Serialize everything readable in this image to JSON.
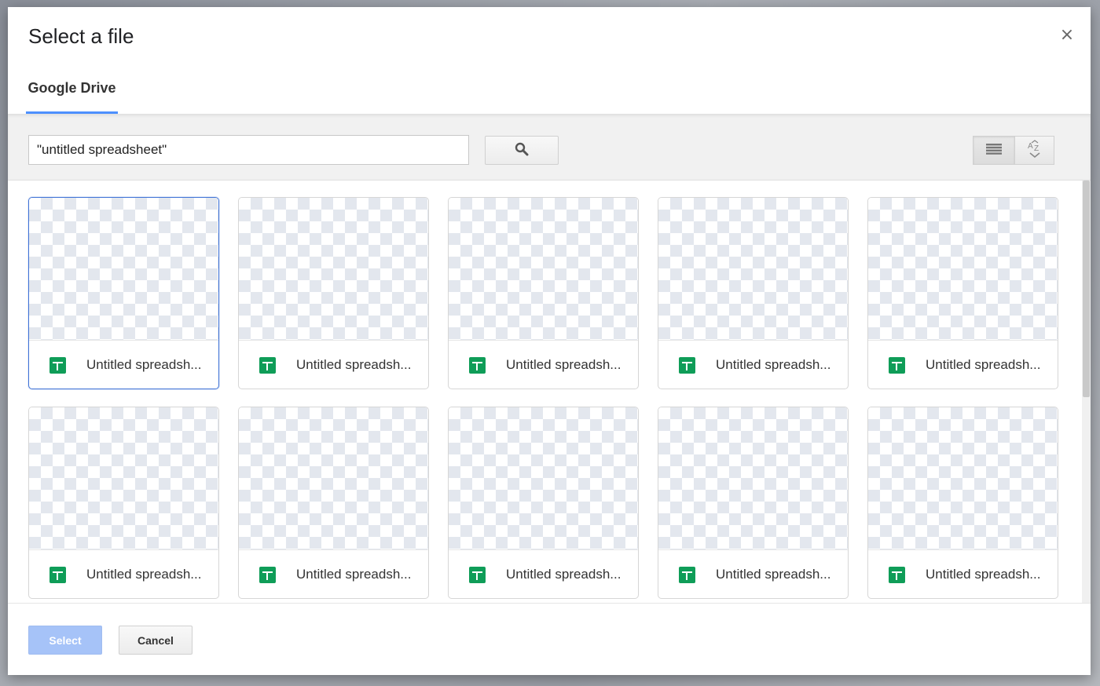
{
  "dialog": {
    "title": "Select a file",
    "close_label": "×",
    "tab_label": "Google Drive"
  },
  "toolbar": {
    "search_value": "\"untitled spreadsheet\"",
    "search_icon": "search-icon",
    "list_view_icon": "list-view-icon",
    "sort_icon": "sort-az-icon"
  },
  "files": [
    {
      "name": "Untitled spreadsh...",
      "selected": true
    },
    {
      "name": "Untitled spreadsh...",
      "selected": false
    },
    {
      "name": "Untitled spreadsh...",
      "selected": false
    },
    {
      "name": "Untitled spreadsh...",
      "selected": false
    },
    {
      "name": "Untitled spreadsh...",
      "selected": false
    },
    {
      "name": "Untitled spreadsh...",
      "selected": false
    },
    {
      "name": "Untitled spreadsh...",
      "selected": false
    },
    {
      "name": "Untitled spreadsh...",
      "selected": false
    },
    {
      "name": "Untitled spreadsh...",
      "selected": false
    },
    {
      "name": "Untitled spreadsh...",
      "selected": false
    }
  ],
  "footer": {
    "select_label": "Select",
    "cancel_label": "Cancel"
  },
  "colors": {
    "accent": "#4d90fe",
    "sheets_green": "#0f9d58",
    "select_disabled": "#a6c3f8"
  }
}
